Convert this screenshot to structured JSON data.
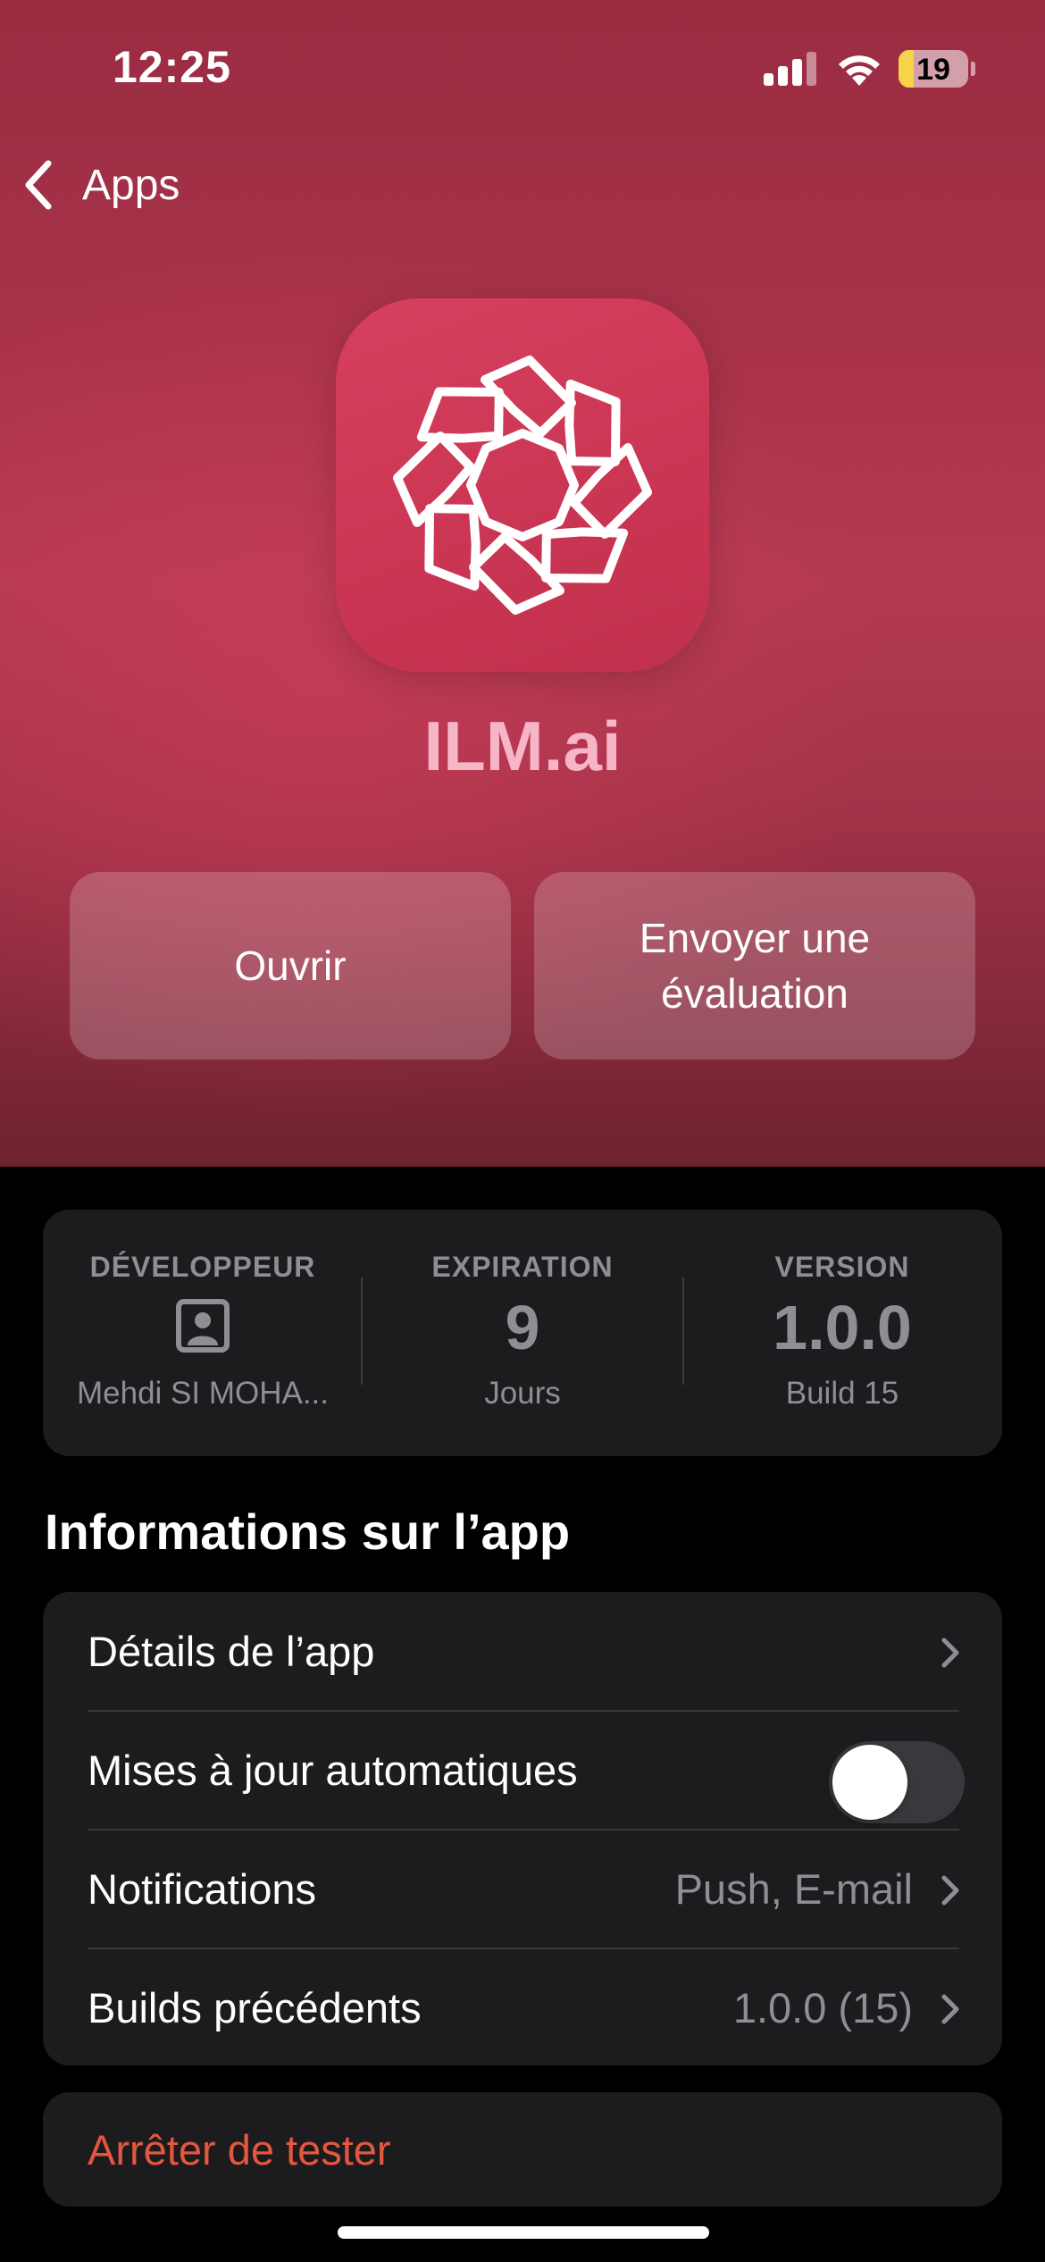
{
  "status_bar": {
    "time": "12:25",
    "battery": "19",
    "battery_level": 0.19
  },
  "nav": {
    "back_label": "Apps"
  },
  "app": {
    "name": "ILM.ai",
    "icon": "ilm-logo-icon",
    "icon_color": "#c93552"
  },
  "actions": {
    "open_label": "Ouvrir",
    "review_label": "Envoyer une évaluation"
  },
  "info": {
    "developer": {
      "label": "DÉVELOPPEUR",
      "icon": "person-portrait-icon",
      "value": "Mehdi SI MOHA..."
    },
    "expiration": {
      "label": "EXPIRATION",
      "value": "9",
      "unit": "Jours"
    },
    "version": {
      "label": "VERSION",
      "value": "1.0.0",
      "build": "Build 15"
    }
  },
  "app_info": {
    "title": "Informations sur l’app",
    "rows": [
      {
        "label": "Détails de l’app",
        "value": ""
      },
      {
        "label": "Mises à jour automatiques",
        "toggle": false
      },
      {
        "label": "Notifications",
        "value": "Push, E-mail"
      },
      {
        "label": "Builds précédents",
        "value": "1.0.0 (15)"
      }
    ]
  },
  "stop": {
    "label": "Arrêter de tester",
    "color": "#e4573f"
  }
}
